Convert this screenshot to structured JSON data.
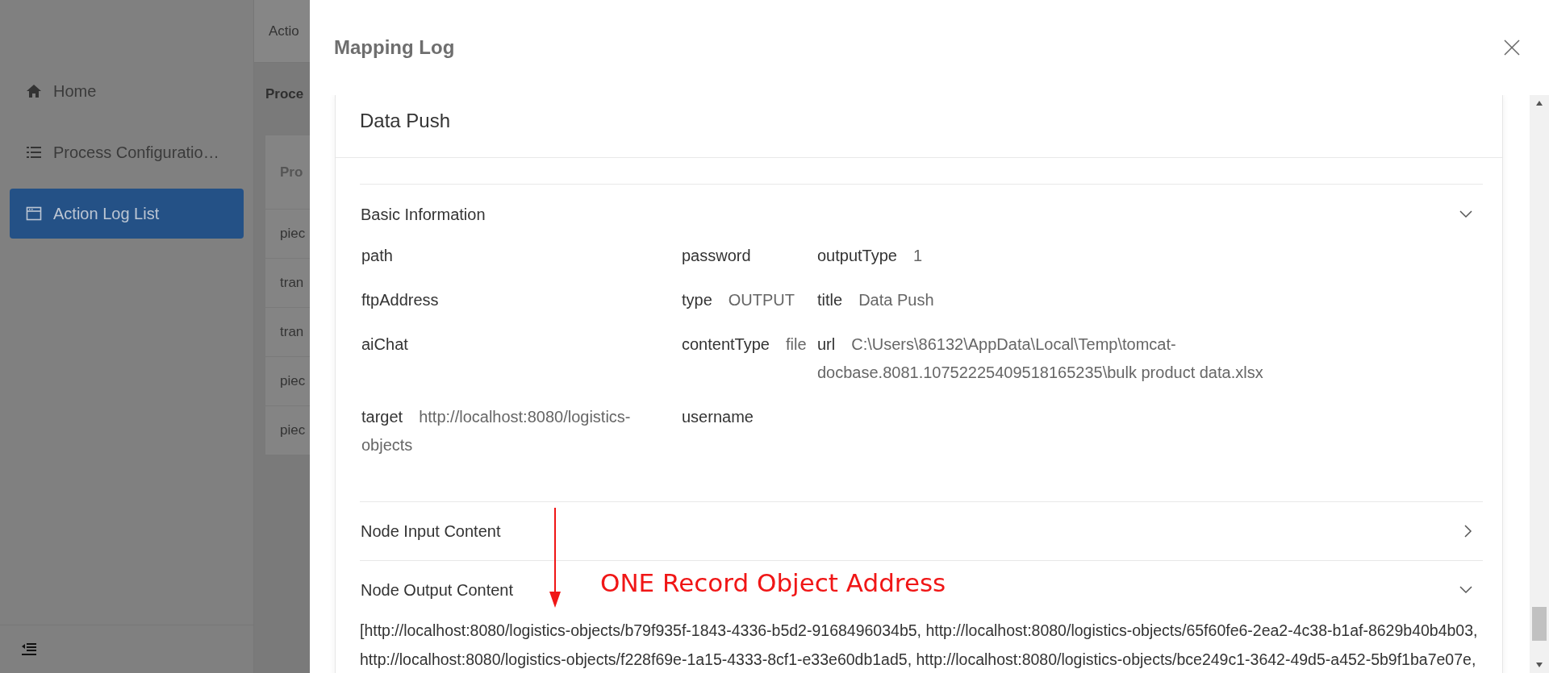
{
  "sidebar": {
    "items": [
      {
        "label": "Home",
        "selected": false
      },
      {
        "label": "Process Configuratio…",
        "selected": false
      },
      {
        "label": "Action Log List",
        "selected": true
      }
    ]
  },
  "background": {
    "tab": "Actio",
    "heading": "Proce",
    "table_header": "Pro",
    "rows": [
      "piec",
      "tran",
      "tran",
      "piec",
      "piec"
    ]
  },
  "drawer": {
    "title": "Mapping Log",
    "card_title": "Data Push",
    "panels": [
      {
        "title": "Basic Information",
        "expanded": true,
        "fields": [
          [
            {
              "label": "path"
            },
            {
              "label": "password"
            },
            {
              "label": "outputType",
              "value": "1"
            }
          ],
          [
            {
              "label": "ftpAddress"
            },
            {
              "label": "type",
              "value": "OUTPUT"
            },
            {
              "label": "title",
              "value": "Data Push"
            }
          ],
          [
            {
              "label": "aiChat"
            },
            {
              "label": "contentType",
              "value": "file"
            },
            {
              "label": "url",
              "value": "C:\\Users\\86132\\AppData\\Local\\Temp\\tomcat-docbase.8081.10752225409518165235\\bulk product data.xlsx"
            }
          ],
          [
            {
              "label": "target",
              "value": "http://localhost:8080/logistics-objects"
            },
            {
              "label": "username"
            }
          ]
        ]
      },
      {
        "title": "Node Input Content",
        "expanded": false
      },
      {
        "title": "Node Output Content",
        "expanded": true,
        "lines": [
          "[http://localhost:8080/logistics-objects/b79f935f-1843-4336-b5d2-9168496034b5, http://localhost:8080/logistics-objects/65f60fe6-2ea2-4c38-b1af-8629b40b4b03,",
          "http://localhost:8080/logistics-objects/f228f69e-1a15-4333-8cf1-e33e60db1ad5, http://localhost:8080/logistics-objects/bce249c1-3642-49d5-a452-5b9f1ba7e07e,"
        ]
      }
    ]
  },
  "annotation": "ONE Record Object Address"
}
